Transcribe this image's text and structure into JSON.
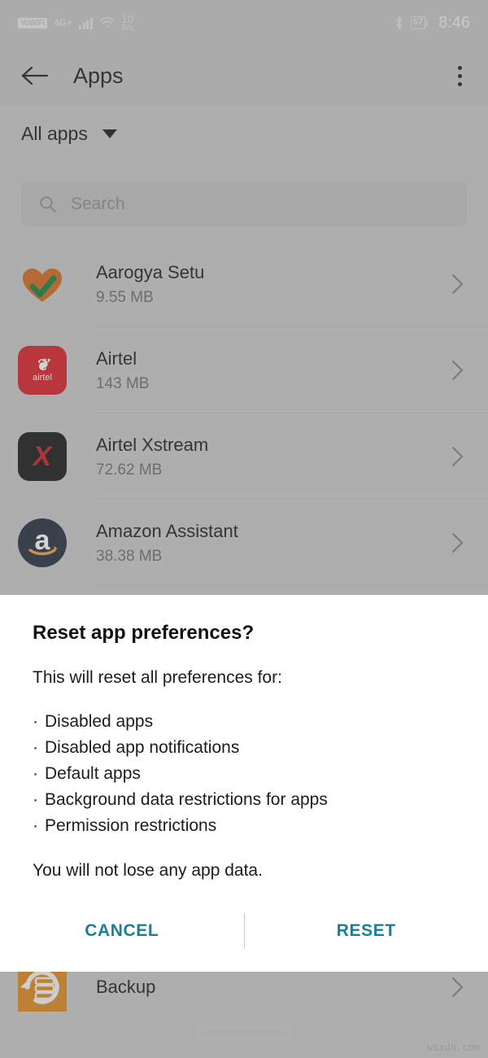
{
  "status_bar": {
    "vowifi_label": "VoWiFi",
    "network_type": "4G+",
    "wifi_icon": "wifi-icon",
    "data_rate_value": "10",
    "data_rate_unit": "B/s",
    "bluetooth_icon": "bluetooth-icon",
    "battery_level": "67",
    "time": "8:46"
  },
  "app_bar": {
    "back_icon": "back-arrow-icon",
    "title": "Apps",
    "overflow_icon": "overflow-menu-icon"
  },
  "filter": {
    "label": "All apps",
    "caret_icon": "chevron-down-icon"
  },
  "search": {
    "icon": "search-icon",
    "placeholder": "Search",
    "value": ""
  },
  "apps": [
    {
      "name": "Aarogya Setu",
      "size": "9.55 MB",
      "icon": "aarogya-setu-icon",
      "chevron": "chevron-right-icon"
    },
    {
      "name": "Airtel",
      "size": "143 MB",
      "icon": "airtel-icon",
      "swoosh": "❦",
      "wordmark": "airtel",
      "chevron": "chevron-right-icon"
    },
    {
      "name": "Airtel Xstream",
      "size": "72.62 MB",
      "icon": "airtel-xstream-icon",
      "glyph": "X",
      "chevron": "chevron-right-icon"
    },
    {
      "name": "Amazon Assistant",
      "size": "38.38 MB",
      "icon": "amazon-assistant-icon",
      "glyph": "a",
      "chevron": "chevron-right-icon"
    }
  ],
  "bottom_app": {
    "name": "Backup",
    "icon": "backup-icon",
    "chevron": "chevron-right-icon"
  },
  "dialog": {
    "title": "Reset app preferences?",
    "lead": "This will reset all preferences for:",
    "bullets": [
      "Disabled apps",
      "Disabled app notifications",
      "Default apps",
      "Background data restrictions for apps",
      "Permission restrictions"
    ],
    "tail": "You will not lose any app data.",
    "cancel_label": "CANCEL",
    "reset_label": "RESET",
    "accent_color": "#1a7f96"
  },
  "nav": {
    "home_indicator": "home-gesture-bar"
  },
  "watermark": "wsxdn.com"
}
